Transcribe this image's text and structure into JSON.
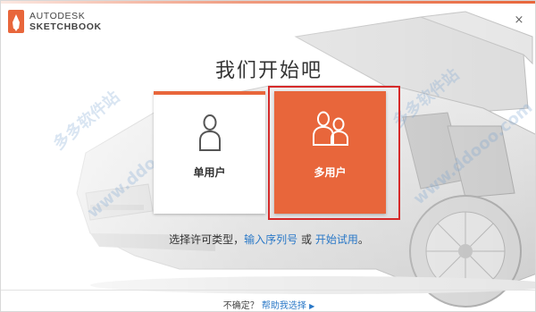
{
  "header": {
    "brand_line1": "AUTODESK",
    "brand_line2": "SKETCHBOOK",
    "close_glyph": "×"
  },
  "title": "我们开始吧",
  "cards": {
    "single": {
      "label": "单用户",
      "icon": "single-user-icon"
    },
    "multi": {
      "label": "多用户",
      "icon": "multi-user-icon"
    }
  },
  "license": {
    "prefix": "选择许可类型，",
    "serial_link": "输入序列号",
    "or": " 或 ",
    "trial_link": "开始试用",
    "suffix": "。"
  },
  "footer": {
    "prefix": "不确定？",
    "help_link": "帮助我选择",
    "arrow": "▶"
  },
  "watermarks": [
    "多多软件站",
    "www.ddooo.com",
    "多多软件站",
    "www.ddooo.com"
  ],
  "colors": {
    "accent": "#e8663b",
    "link": "#2a78c7",
    "selection": "#d62a2a"
  }
}
